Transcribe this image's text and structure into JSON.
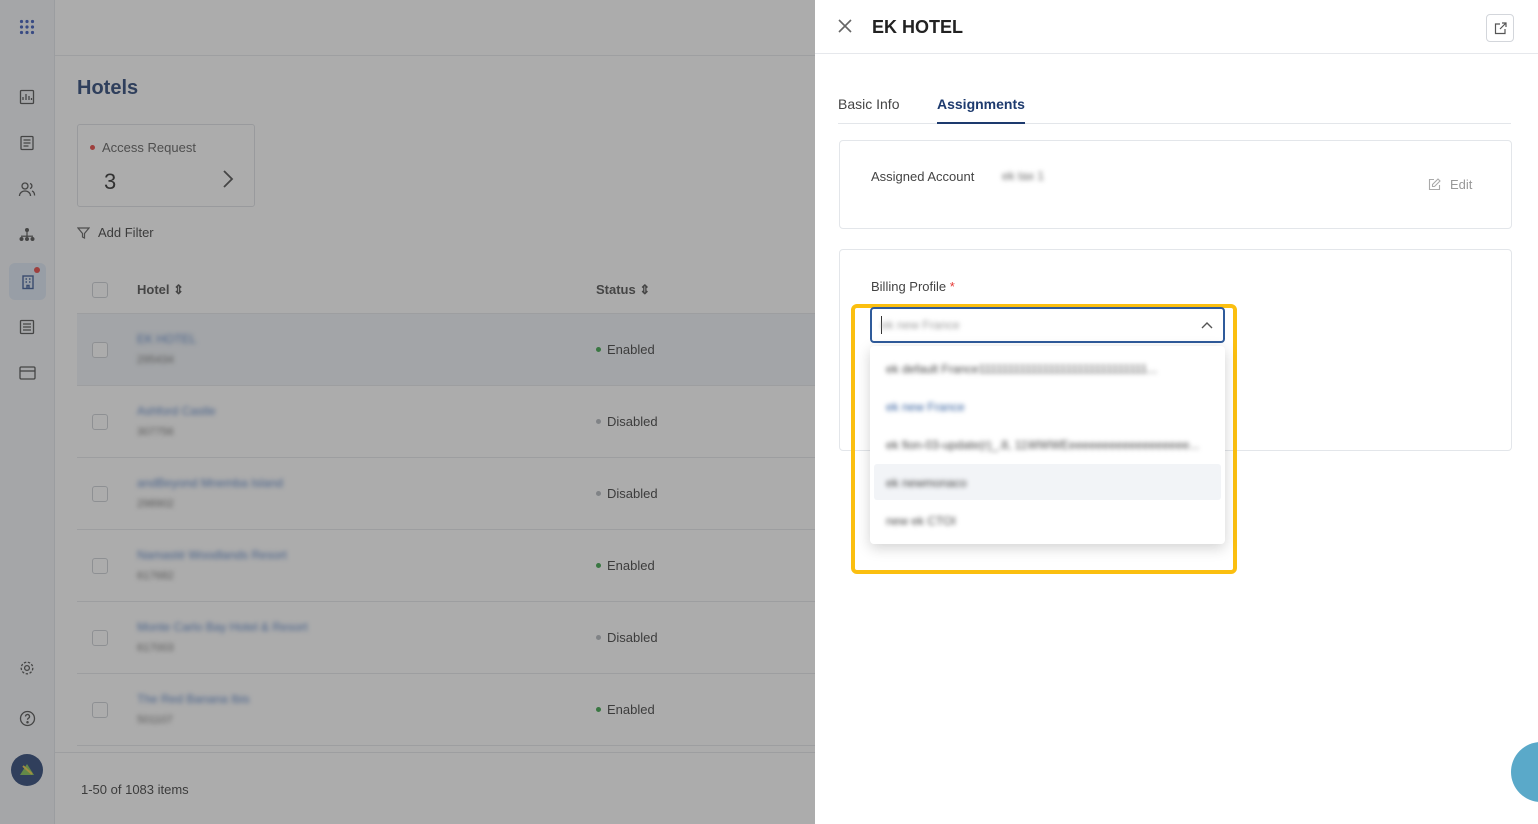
{
  "main": {
    "page_title": "Hotels",
    "access_card": {
      "label": "Access Request",
      "count": "3"
    },
    "add_filter": "Add Filter",
    "columns": {
      "hotel": "Hotel ⇕",
      "status": "Status ⇕"
    },
    "rows": [
      {
        "name": "EK HOTEL",
        "code": "295434",
        "status": "Enabled",
        "selected": true
      },
      {
        "name": "Ashford Castle",
        "code": "307756",
        "status": "Disabled"
      },
      {
        "name": "andBeyond Mnemba Island",
        "code": "298902",
        "status": "Disabled"
      },
      {
        "name": "Namasté Woodlands Resort",
        "code": "617682",
        "status": "Enabled"
      },
      {
        "name": "Monte Carlo Bay Hotel & Resort",
        "code": "617003",
        "status": "Disabled"
      },
      {
        "name": "The Red Banana Ibis",
        "code": "501107",
        "status": "Enabled"
      }
    ],
    "pagination": "1-50 of 1083 items"
  },
  "drawer": {
    "title": "EK HOTEL",
    "tabs": [
      "Basic Info",
      "Assignments"
    ],
    "active_tab": "Assignments",
    "assigned_account_label": "Assigned Account",
    "assigned_account_value": "ek tax 1",
    "edit_label": "Edit",
    "billing_profile_label": "Billing Profile",
    "required_mark": "*",
    "select_placeholder": "ek new France",
    "options": [
      "ek default France11111111111111111111111111111...",
      "ek new France",
      "ek fion-03-update(r)_.8, 11WWWEeeeeeeeeeeeeeeeeee...",
      "ek newmonaco",
      "new ek CTOI"
    ]
  },
  "colors": {
    "brand": "#1d3a6e",
    "highlight": "#fbbf10",
    "enabled": "#2e9e3e",
    "disabled": "#b0b4ba"
  }
}
